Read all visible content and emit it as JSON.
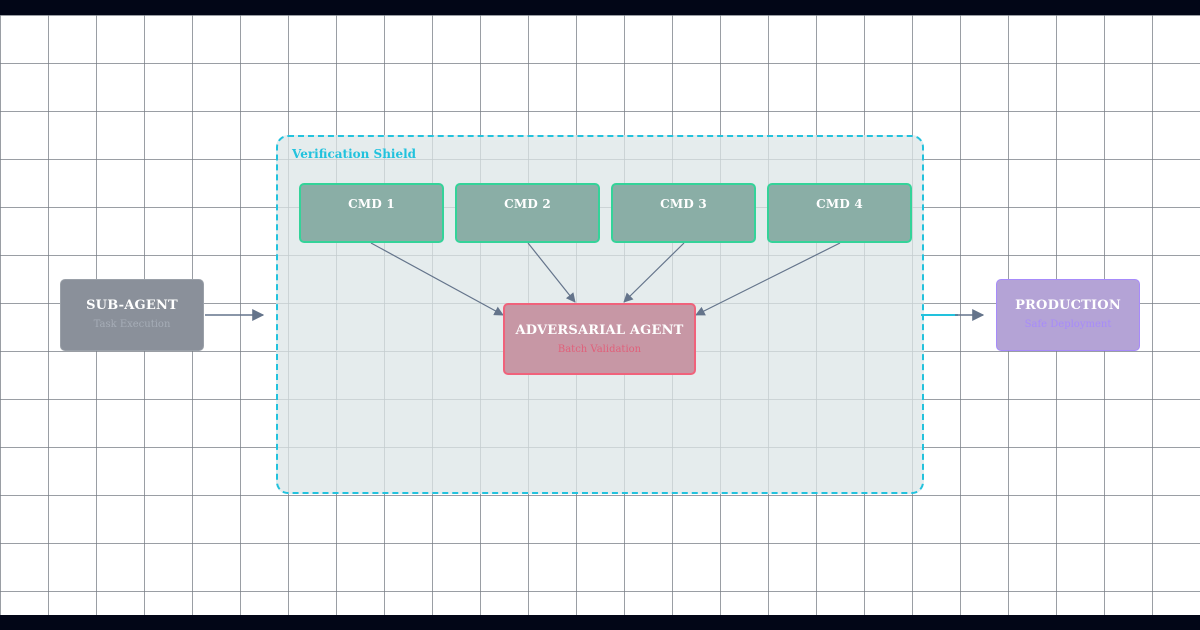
{
  "diagram": {
    "shield_label": "Verification Shield",
    "nodes": {
      "sub_agent": {
        "title": "SUB-AGENT",
        "subtitle": "Task Execution"
      },
      "commands": [
        {
          "title": "CMD 1"
        },
        {
          "title": "CMD 2"
        },
        {
          "title": "CMD 3"
        },
        {
          "title": "CMD 4"
        }
      ],
      "adversarial": {
        "title": "ADVERSARIAL AGENT",
        "subtitle": "Batch Validation"
      },
      "production": {
        "title": "PRODUCTION",
        "subtitle": "Safe Deployment"
      }
    },
    "colors": {
      "shield_border": "#22c2dd",
      "sub_agent_fill": "#8a909a",
      "command_border": "#34d399",
      "adversarial_border": "#f0627b",
      "production_border": "#a78bfa",
      "edge": "#64748b",
      "top_bottom_bar": "#020617"
    }
  }
}
